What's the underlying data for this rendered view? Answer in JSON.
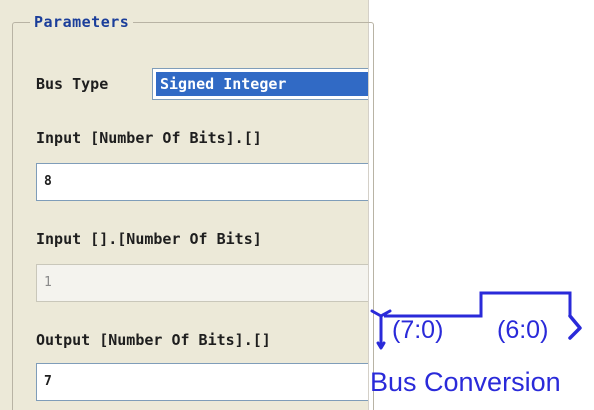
{
  "dialog": {
    "group_title": "Parameters",
    "bus_type": {
      "label": "Bus Type",
      "selected": "Signed Integer"
    },
    "input_int_bits": {
      "label": "Input [Number Of Bits].[]",
      "value": "8"
    },
    "input_frac_bits": {
      "label": "Input [].[Number Of Bits]",
      "value": "1",
      "disabled": true
    },
    "output_int_bits": {
      "label": "Output [Number Of Bits].[]",
      "value": "7"
    }
  },
  "block": {
    "title": "Bus Conversion",
    "input_port": "(7:0)",
    "output_port": "(6:0)",
    "color": "#2a2ad9"
  },
  "colors": {
    "panel_bg": "#ece9d8",
    "selection": "#316ac5",
    "group_title": "#1b3e9a"
  }
}
